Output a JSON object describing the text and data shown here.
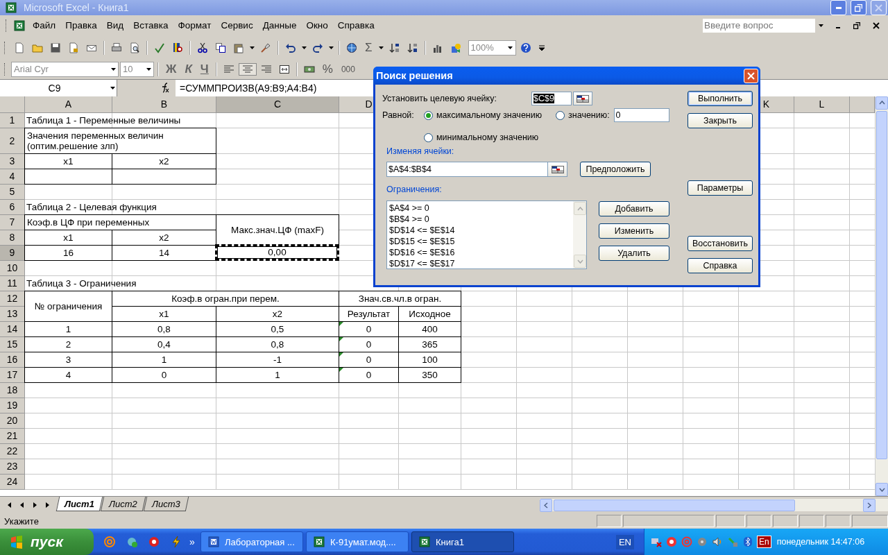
{
  "window": {
    "title": "Microsoft Excel - Книга1"
  },
  "menu": [
    "Файл",
    "Правка",
    "Вид",
    "Вставка",
    "Формат",
    "Сервис",
    "Данные",
    "Окно",
    "Справка"
  ],
  "help_search": {
    "placeholder": "Введите вопрос"
  },
  "toolbar": {
    "sum": "Σ",
    "zoom": "100%",
    "font": "Arial Cyr",
    "font_size": "10",
    "bold": "Ж",
    "italic": "К",
    "underline": "Ч",
    "percent": "%",
    "thousands": "000"
  },
  "formula_bar": {
    "name_box": "C9",
    "formula": "=СУММПРОИЗВ(A9:B9;A4:B4)"
  },
  "sheet": {
    "columns": [
      {
        "label": "A",
        "selected": false
      },
      {
        "label": "B",
        "selected": false
      },
      {
        "label": "C",
        "selected": true
      },
      {
        "label": "D",
        "selected": false
      },
      null,
      null,
      null,
      null,
      null,
      null,
      {
        "label": "K",
        "selected": false
      },
      {
        "label": "L",
        "selected": false
      }
    ],
    "rows": [
      {
        "label": "1",
        "selected": false,
        "cells": [
          {
            "kind": "title",
            "text": "Таблица 1 - Переменные величины",
            "across": true
          }
        ]
      },
      {
        "label": "2",
        "selected": false,
        "cells": [
          {
            "kind": "note",
            "text": "Значения переменных величин (оптим.решение злп)",
            "across": true
          }
        ]
      },
      {
        "label": "3",
        "selected": false,
        "cells": [
          {
            "kind": "cell",
            "text": "x1"
          },
          {
            "kind": "cell",
            "text": "x2"
          }
        ]
      },
      {
        "label": "4",
        "selected": false,
        "cells": [
          {
            "kind": "cell"
          },
          {
            "kind": "cell"
          }
        ]
      },
      {
        "label": "5",
        "selected": false
      },
      {
        "label": "6",
        "selected": false,
        "cells": [
          {
            "kind": "title",
            "text": "Таблица 2 - Целевая функция",
            "across": true
          }
        ]
      },
      {
        "label": "7",
        "selected": false,
        "cells": [
          {
            "kind": "note",
            "text": "Коэф.в ЦФ при переменных",
            "across": true
          },
          null,
          {
            "kind": "cell",
            "text": "Макс.знач.ЦФ (maxF)",
            "down": true
          }
        ]
      },
      {
        "label": "8",
        "selected": false,
        "cells": [
          {
            "kind": "cell",
            "text": "x1"
          },
          {
            "kind": "cell",
            "text": "x2"
          }
        ]
      },
      {
        "label": "9",
        "selected": true,
        "cells": [
          {
            "kind": "cell",
            "text": "16"
          },
          {
            "kind": "cell",
            "text": "14"
          },
          {
            "kind": "cell",
            "text": "0,00",
            "marquee": true
          }
        ]
      },
      {
        "label": "10",
        "selected": false
      },
      {
        "label": "11",
        "selected": false,
        "cells": [
          {
            "kind": "title",
            "text": "Таблица 3 - Ограничения",
            "across": true
          }
        ]
      },
      {
        "label": "12",
        "selected": false,
        "cells": [
          {
            "kind": "cell",
            "text": "№ ограничения",
            "down": true
          },
          {
            "kind": "cell",
            "text": "Коэф.в огран.при перем.",
            "across": true
          },
          null,
          {
            "kind": "cell",
            "text": "Знач.св.чл.в огран.",
            "across": true
          }
        ]
      },
      {
        "label": "13",
        "selected": false,
        "cells": [
          null,
          {
            "kind": "cell",
            "text": "x1"
          },
          {
            "kind": "cell",
            "text": "x2"
          },
          {
            "kind": "cell",
            "text": "Результат"
          },
          {
            "kind": "cell",
            "text": "Исходное"
          }
        ]
      },
      {
        "label": "14",
        "selected": false,
        "cells": [
          {
            "kind": "cell",
            "text": "1"
          },
          {
            "kind": "cell",
            "text": "0,8"
          },
          {
            "kind": "cell",
            "text": "0,5"
          },
          {
            "kind": "cell",
            "text": "0",
            "flag": true
          },
          {
            "kind": "cell",
            "text": "400"
          }
        ]
      },
      {
        "label": "15",
        "selected": false,
        "cells": [
          {
            "kind": "cell",
            "text": "2"
          },
          {
            "kind": "cell",
            "text": "0,4"
          },
          {
            "kind": "cell",
            "text": "0,8"
          },
          {
            "kind": "cell",
            "text": "0",
            "flag": true
          },
          {
            "kind": "cell",
            "text": "365"
          }
        ]
      },
      {
        "label": "16",
        "selected": false,
        "cells": [
          {
            "kind": "cell",
            "text": "3"
          },
          {
            "kind": "cell",
            "text": "1"
          },
          {
            "kind": "cell",
            "text": "-1"
          },
          {
            "kind": "cell",
            "text": "0",
            "flag": true
          },
          {
            "kind": "cell",
            "text": "100"
          }
        ]
      },
      {
        "label": "17",
        "selected": false,
        "cells": [
          {
            "kind": "cell",
            "text": "4"
          },
          {
            "kind": "cell",
            "text": "0"
          },
          {
            "kind": "cell",
            "text": "1"
          },
          {
            "kind": "cell",
            "text": "0",
            "flag": true
          },
          {
            "kind": "cell",
            "text": "350"
          }
        ]
      },
      {
        "label": "18",
        "selected": false
      },
      {
        "label": "19",
        "selected": false
      },
      {
        "label": "20",
        "selected": false
      },
      {
        "label": "21",
        "selected": false
      },
      {
        "label": "22",
        "selected": false
      },
      {
        "label": "23",
        "selected": false
      },
      {
        "label": "24",
        "selected": false
      }
    ]
  },
  "sheet_tabs": [
    {
      "label": "Лист1",
      "selected": true
    },
    {
      "label": "Лист2",
      "selected": false
    },
    {
      "label": "Лист3",
      "selected": false
    }
  ],
  "status_bar": {
    "text": "Укажите"
  },
  "dialog": {
    "title": "Поиск решения",
    "target_label": "Установить целевую ячейку:",
    "target": "$C$9",
    "equal_label": "Равной:",
    "options": [
      {
        "label": "максимальному значению",
        "selected": true
      },
      {
        "label": "значению:",
        "selected": false
      },
      {
        "label": "минимальному значению",
        "selected": false
      }
    ],
    "value": "0",
    "changing_label": "Изменяя ячейки:",
    "changing": "$A$4:$B$4",
    "guess": "Предположить",
    "constraints_label": "Ограничения:",
    "constraints": [
      "$A$4 >= 0",
      "$B$4 >= 0",
      "$D$14 <= $E$14",
      "$D$15 <= $E$15",
      "$D$16 <= $E$16",
      "$D$17 <= $E$17"
    ],
    "constraint_buttons": [
      "Добавить",
      "Изменить",
      "Удалить"
    ],
    "side_buttons": [
      {
        "label": "Выполнить",
        "default": true
      },
      {
        "label": "Закрыть",
        "default": false
      },
      {
        "label": "Параметры",
        "default": false
      },
      {
        "label": "Восстановить",
        "default": false
      },
      {
        "label": "Справка",
        "default": false
      }
    ]
  },
  "taskbar": {
    "start": "пуск",
    "more": "»",
    "tasks": [
      {
        "label": "Лабораторная ...",
        "kind": "word",
        "selected": false
      },
      {
        "label": "К-91умат.мод....",
        "kind": "excel",
        "selected": false
      },
      {
        "label": "Книга1",
        "kind": "excel",
        "selected": true
      }
    ],
    "language": "EN",
    "tray_language": "En",
    "clock": "понедельник 14:47:06"
  }
}
